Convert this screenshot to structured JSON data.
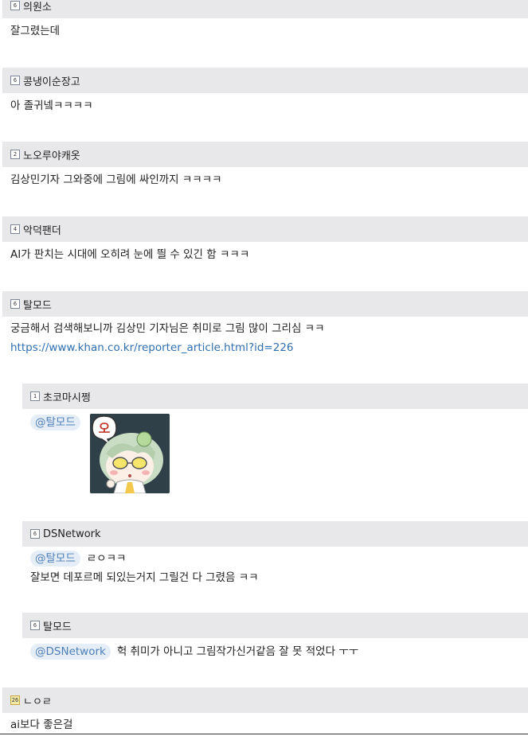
{
  "comments": [
    {
      "nick": "의원소",
      "level": "6",
      "lines": [
        "잘그렸는데"
      ]
    },
    {
      "nick": "콩냉이순장고",
      "level": "6",
      "lines": [
        "아 졸귀넼ㅋㅋㅋㅋ"
      ]
    },
    {
      "nick": "노오루야캐옷",
      "level": "2",
      "lines": [
        "김상민기자 그와중에 그림에 싸인까지 ㅋㅋㅋㅋ"
      ]
    },
    {
      "nick": "악덕팬더",
      "level": "4",
      "lines": [
        "AI가 판치는 시대에 오히려 눈에 띌 수 있긴 함 ㅋㅋㅋ"
      ]
    },
    {
      "nick": "탈모드",
      "level": "6",
      "lines": [
        "궁금해서 검색해보니까 김상민 기자님은 취미로 그림 많이 그리심 ㅋㅋ"
      ],
      "link": "https://www.khan.co.kr/reporter_article.html?id=226"
    }
  ],
  "replies": [
    {
      "nick": "초코마시쩡",
      "level": "1",
      "mention": "@탈모드",
      "sticker_text": "오"
    },
    {
      "nick": "DSNetwork",
      "level": "6",
      "mention": "@탈모드",
      "inline_text": "ㄹㅇㅋㅋ",
      "lines": [
        "잘보면 데포르메 되있는거지 그릴건 다 그렸음 ㅋㅋ"
      ]
    },
    {
      "nick": "탈모드",
      "level": "6",
      "mention": "@DSNetwork",
      "inline_text": "헉 취미가 아니고 그림작가신거같음 잘 못 적었다 ㅜㅜ"
    }
  ],
  "last_comment": {
    "nick": "ㄴㅇㄹ",
    "level": "26",
    "lines": [
      "ai보다 좋은걸"
    ]
  }
}
